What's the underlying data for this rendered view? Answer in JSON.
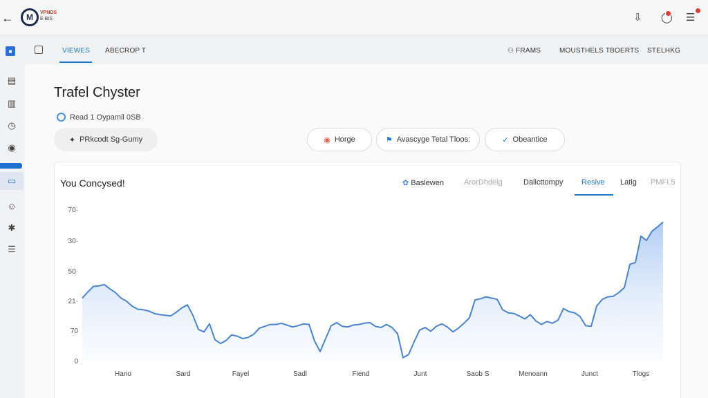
{
  "header": {
    "logo_text": "VPNDS",
    "logo_subtext": "E BIS"
  },
  "tabs": [
    {
      "label": "VIEWES",
      "active": true
    },
    {
      "label": "ABECROP T",
      "active": false
    }
  ],
  "right_tabs": [
    {
      "label": "FRAMS"
    },
    {
      "label": "MOUSTHELS TBOERTS"
    },
    {
      "label": "STELHKG"
    }
  ],
  "page": {
    "title": "Trafel Chyster",
    "subtitle": "Read 1 Oypamil 0SB"
  },
  "pills": [
    {
      "label": "PRkcodt Sg-Gumy",
      "icon": "sparkle-icon"
    },
    {
      "label": "Horge",
      "icon": "shield-icon"
    },
    {
      "label": "Avascyge Tetal Tloos:",
      "icon": "flag-icon"
    },
    {
      "label": "Obeantice",
      "icon": "check-icon"
    }
  ],
  "card": {
    "title": "You Concysed!",
    "tabs": [
      {
        "label": "Baslewen",
        "state": "normal"
      },
      {
        "label": "ArorDhdeig",
        "state": "dim"
      },
      {
        "label": "Dalicttompy",
        "state": "normal"
      },
      {
        "label": "Resive",
        "state": "active"
      },
      {
        "label": "Latig",
        "state": "normal"
      },
      {
        "label": "PMFI.5",
        "state": "dim"
      }
    ]
  },
  "colors": {
    "accent": "#1e78c8",
    "line": "#4a84cc",
    "area_top": "#a9c8f2",
    "notification": "#e53935"
  },
  "chart_data": {
    "type": "area",
    "ytick_labels": [
      "0",
      "70",
      "21·",
      "50·",
      "30·",
      "70·"
    ],
    "xtick_labels": [
      "Hario",
      "Sard",
      "Fayel",
      "Sadl",
      "Fiend",
      "Junt",
      "Saob S",
      "Menoann",
      "Junct",
      "Tlogs"
    ],
    "ylim": [
      0,
      250
    ],
    "values": [
      102,
      112,
      121,
      122,
      124,
      117,
      111,
      102,
      97,
      89,
      84,
      83,
      81,
      77,
      75,
      74,
      73,
      79,
      86,
      91,
      74,
      51,
      47,
      60,
      34,
      28,
      33,
      42,
      40,
      36,
      38,
      43,
      53,
      56,
      59,
      59,
      61,
      58,
      55,
      57,
      60,
      59,
      32,
      15,
      36,
      57,
      62,
      56,
      55,
      58,
      59,
      61,
      62,
      56,
      54,
      59,
      54,
      44,
      5,
      10,
      31,
      50,
      54,
      48,
      56,
      60,
      55,
      47,
      53,
      61,
      70,
      99,
      101,
      104,
      102,
      100,
      83,
      78,
      77,
      73,
      68,
      75,
      65,
      59,
      64,
      61,
      66,
      85,
      80,
      78,
      72,
      57,
      56,
      89,
      100,
      104,
      105,
      111,
      119,
      157,
      160,
      203,
      196,
      211,
      218,
      226
    ]
  }
}
